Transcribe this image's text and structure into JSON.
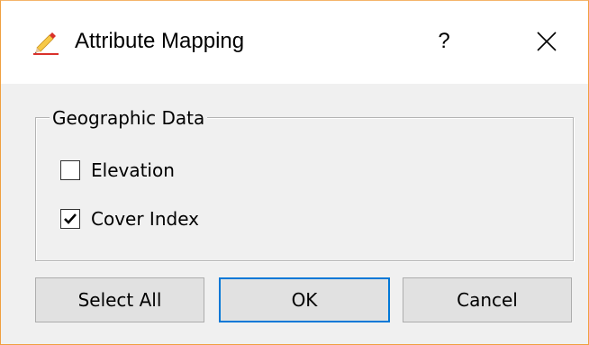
{
  "window": {
    "title": "Attribute Mapping",
    "help_label": "?",
    "close_label": "✕"
  },
  "group": {
    "title": "Geographic Data",
    "items": [
      {
        "label": "Elevation",
        "checked": false
      },
      {
        "label": "Cover Index",
        "checked": true
      }
    ]
  },
  "buttons": {
    "select_all": "Select All",
    "ok": "OK",
    "cancel": "Cancel"
  },
  "colors": {
    "accent": "#0078d7",
    "window_border": "#f0a040",
    "dialog_bg": "#f0f0f0",
    "button_bg": "#e1e1e1"
  },
  "icons": {
    "title_icon": "pencil-icon",
    "checkmark": "checkmark-icon"
  }
}
